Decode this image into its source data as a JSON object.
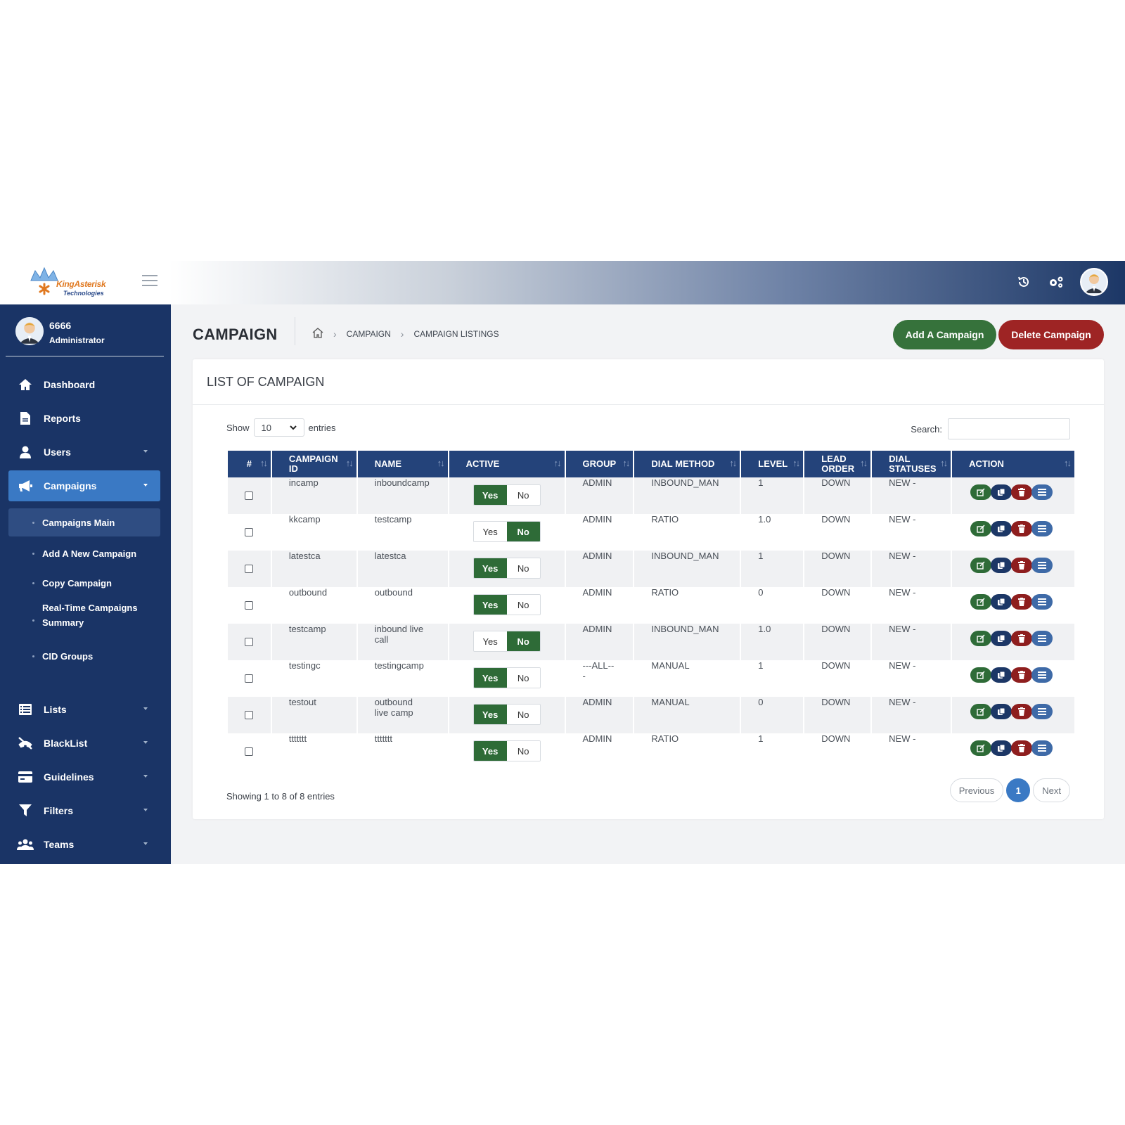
{
  "brand": {
    "name": "KingAsterisk",
    "tagline": "Technologies"
  },
  "profile": {
    "name": "6666",
    "role": "Administrator"
  },
  "sidebar": {
    "items": [
      {
        "label": "Dashboard",
        "icon": "home-icon"
      },
      {
        "label": "Reports",
        "icon": "document-icon"
      },
      {
        "label": "Users",
        "icon": "user-icon"
      },
      {
        "label": "Campaigns",
        "icon": "megaphone-icon"
      },
      {
        "label": "Lists",
        "icon": "list-icon"
      },
      {
        "label": "BlackList",
        "icon": "blocked-phone-icon"
      },
      {
        "label": "Guidelines",
        "icon": "card-icon"
      },
      {
        "label": "Filters",
        "icon": "filter-icon"
      },
      {
        "label": "Teams",
        "icon": "team-icon"
      }
    ],
    "sub_items": [
      {
        "label": "Campaigns Main"
      },
      {
        "label": "Add A New Campaign"
      },
      {
        "label": "Copy Campaign"
      },
      {
        "label": "Real-Time Campaigns",
        "label2": "Summary"
      },
      {
        "label": "CID Groups"
      }
    ]
  },
  "header": {
    "title": "CAMPAIGN",
    "breadcrumb": [
      "CAMPAIGN",
      "CAMPAIGN LISTINGS"
    ],
    "add_button": "Add A Campaign",
    "delete_button": "Delete Campaign"
  },
  "card": {
    "title": "LIST OF CAMPAIGN",
    "show_label": "Show",
    "entries_value": "10",
    "entries_label": "entries",
    "search_label": "Search:",
    "info": "Showing 1 to 8 of 8 entries",
    "prev_label": "Previous",
    "page": "1",
    "next_label": "Next"
  },
  "table": {
    "columns": [
      {
        "l1": "#",
        "l2": ""
      },
      {
        "l1": "CAMPAIGN",
        "l2": "ID"
      },
      {
        "l1": "NAME",
        "l2": ""
      },
      {
        "l1": "ACTIVE",
        "l2": ""
      },
      {
        "l1": "GROUP",
        "l2": ""
      },
      {
        "l1": "DIAL METHOD",
        "l2": ""
      },
      {
        "l1": "LEVEL",
        "l2": ""
      },
      {
        "l1": "LEAD",
        "l2": "ORDER"
      },
      {
        "l1": "DIAL",
        "l2": "STATUSES"
      },
      {
        "l1": "ACTION",
        "l2": ""
      }
    ],
    "yes_label": "Yes",
    "no_label": "No",
    "rows": [
      {
        "id": "incamp",
        "name": "inboundcamp",
        "name2": "",
        "active": true,
        "group": "ADMIN",
        "group2": "",
        "method": "INBOUND_MAN",
        "level": "1",
        "lead_order": "DOWN",
        "statuses": "NEW -"
      },
      {
        "id": "kkcamp",
        "name": "testcamp",
        "name2": "",
        "active": false,
        "group": "ADMIN",
        "group2": "",
        "method": "RATIO",
        "level": "1.0",
        "lead_order": "DOWN",
        "statuses": "NEW -"
      },
      {
        "id": "latestca",
        "name": "latestca",
        "name2": "",
        "active": true,
        "group": "ADMIN",
        "group2": "",
        "method": "INBOUND_MAN",
        "level": "1",
        "lead_order": "DOWN",
        "statuses": "NEW -"
      },
      {
        "id": "outbound",
        "name": "outbound",
        "name2": "",
        "active": true,
        "group": "ADMIN",
        "group2": "",
        "method": "RATIO",
        "level": "0",
        "lead_order": "DOWN",
        "statuses": "NEW -"
      },
      {
        "id": "testcamp",
        "name": "inbound live",
        "name2": "call",
        "active": false,
        "group": "ADMIN",
        "group2": "",
        "method": "INBOUND_MAN",
        "level": "1.0",
        "lead_order": "DOWN",
        "statuses": "NEW -"
      },
      {
        "id": "testingc",
        "name": "testingcamp",
        "name2": "",
        "active": true,
        "group": "---ALL--",
        "group2": "-",
        "method": "MANUAL",
        "level": "1",
        "lead_order": "DOWN",
        "statuses": "NEW -"
      },
      {
        "id": "testout",
        "name": "outbound",
        "name2": "live camp",
        "active": true,
        "group": "ADMIN",
        "group2": "",
        "method": "MANUAL",
        "level": "0",
        "lead_order": "DOWN",
        "statuses": "NEW -"
      },
      {
        "id": "ttttttt",
        "name": "ttttttt",
        "name2": "",
        "active": true,
        "group": "ADMIN",
        "group2": "",
        "method": "RATIO",
        "level": "1",
        "lead_order": "DOWN",
        "statuses": "NEW -"
      }
    ]
  },
  "colors": {
    "sidebar": "#1a3466",
    "accent": "#3a79c4",
    "success": "#2e6b37",
    "danger": "#9e2424",
    "header_row": "#24437a"
  }
}
